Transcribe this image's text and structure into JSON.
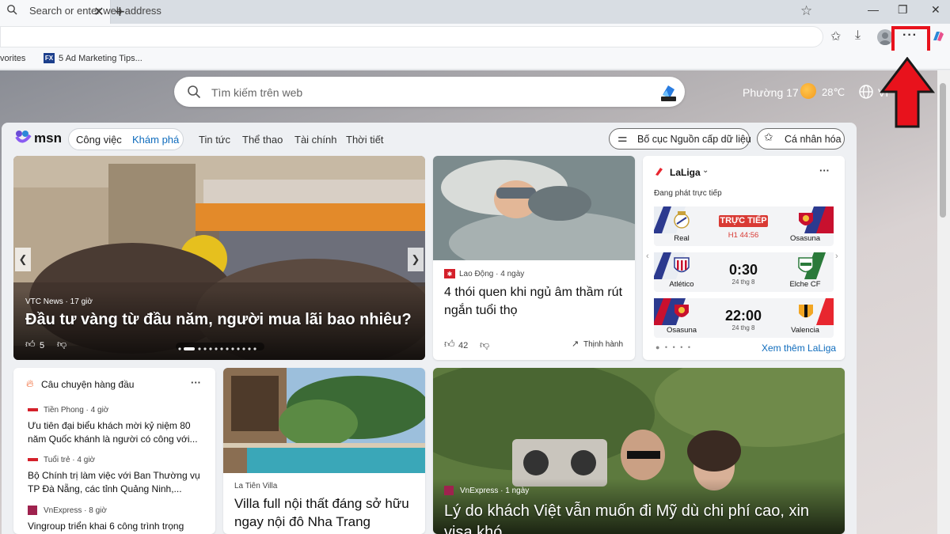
{
  "browser": {
    "address_placeholder": "Search or enter web address",
    "favorites_label": "vorites",
    "favorite_item": "5 Ad Marketing Tips...",
    "favicon_text": "FX",
    "more_label": "···",
    "highlight_color": "#e8121c"
  },
  "msn": {
    "search_placeholder": "Tìm kiếm trên web",
    "weather_location": "Phường 17",
    "weather_temp": "28℃",
    "language": "VI",
    "logo_text": "msn",
    "nav": {
      "work": "Công việc",
      "explore": "Khám phá",
      "news": "Tin tức",
      "sports": "Thể thao",
      "finance": "Tài chính",
      "weather": "Thời tiết"
    },
    "layout_button": "Bố cục Nguồn cấp dữ liệu",
    "personalize_button": "Cá nhân hóa"
  },
  "hero": {
    "source": "VTC News · 17 giờ",
    "title": "Đầu tư vàng từ đầu năm, người mua lãi bao nhiêu?",
    "likes": "5"
  },
  "card2": {
    "source": "Lao Động · 4 ngày",
    "title": "4 thói quen khi ngủ âm thầm rút ngắn tuổi thọ",
    "likes": "42",
    "trending": "Thịnh hành"
  },
  "laliga": {
    "title": "LaLiga",
    "live_label": "Đang phát trực tiếp",
    "live_badge": "TRỰC TIẾP",
    "matches": [
      {
        "home": "Real",
        "away": "Osasuna",
        "score": "",
        "sub": "H1 44:56"
      },
      {
        "home": "Atlético",
        "away": "Elche CF",
        "score": "0:30",
        "sub": "24 thg 8"
      },
      {
        "home": "Osasuna",
        "away": "Valencia",
        "score": "22:00",
        "sub": "24 thg 8"
      }
    ],
    "see_more": "Xem thêm LaLiga"
  },
  "top_stories": {
    "title": "Câu chuyện hàng đầu",
    "items": [
      {
        "source": "Tiền Phong · 4 giờ",
        "title": "Ưu tiên đại biểu khách mời kỷ niệm 80 năm Quốc khánh là người có công với..."
      },
      {
        "source": "Tuổi trẻ · 4 giờ",
        "title": "Bộ Chính trị làm việc với Ban Thường vụ TP Đà Nẵng, các tỉnh Quảng Ninh,..."
      },
      {
        "source": "VnExpress · 8 giờ",
        "title": "Vingroup triển khai 6 công trình trọng"
      }
    ]
  },
  "villa": {
    "source": "La Tiên Villa",
    "title": "Villa full nội thất đáng sở hữu ngay nội đô Nha Trang"
  },
  "big": {
    "source": "VnExpress · 1 ngày",
    "title": "Lý do khách Việt vẫn muốn đi Mỹ dù chi phí cao, xin visa khó"
  }
}
